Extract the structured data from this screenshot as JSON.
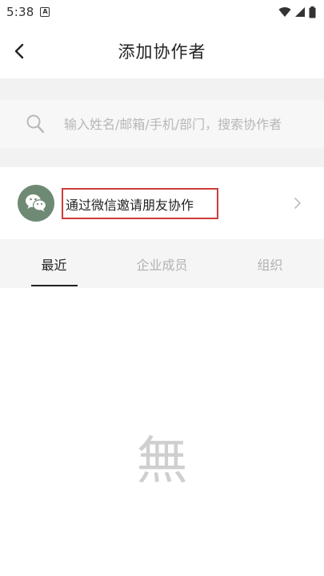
{
  "status_bar": {
    "time": "5:38",
    "app_indicator": "A",
    "icons": [
      "wifi-icon",
      "signal-icon",
      "battery-icon"
    ]
  },
  "header": {
    "back_icon": "chevron-left-icon",
    "title": "添加协作者"
  },
  "search": {
    "icon": "search-icon",
    "placeholder": "输入姓名/邮箱/手机/部门，搜索协作者",
    "value": ""
  },
  "invite": {
    "icon": "wechat-icon",
    "label": "通过微信邀请朋友协作",
    "chevron_icon": "chevron-right-icon",
    "highlight_color": "#cf3b3b",
    "avatar_color": "#6f8a74"
  },
  "tabs": [
    {
      "label": "最近",
      "active": true
    },
    {
      "label": "企业成员",
      "active": false
    },
    {
      "label": "组织",
      "active": false
    }
  ],
  "empty_state": {
    "glyph": "無"
  }
}
